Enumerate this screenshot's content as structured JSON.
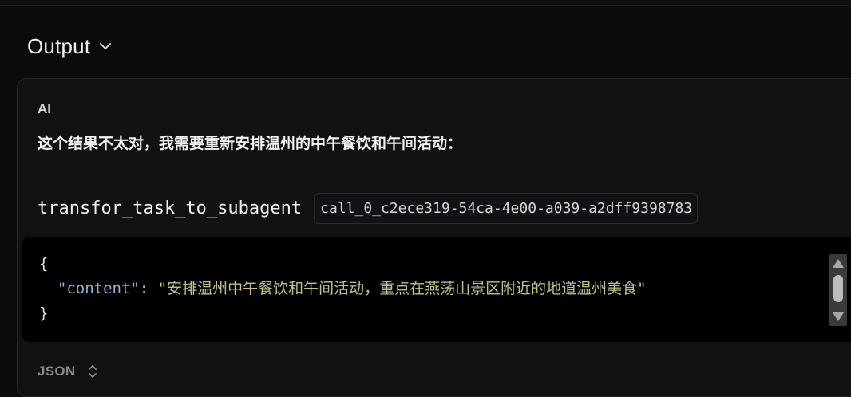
{
  "output": {
    "title": "Output"
  },
  "message": {
    "role_label": "AI",
    "text": "这个结果不太对，我需要重新安排温州的中午餐饮和午间活动："
  },
  "tool_call": {
    "name": "transfor_task_to_subagent",
    "call_id": "call_0_c2ece319-54ca-4e00-a039-a2dff9398783",
    "args": {
      "open_brace": "{",
      "key": "\"content\"",
      "colon": ": ",
      "value": "\"安排温州中午餐饮和午间活动，重点在燕荡山景区附近的地道温州美食\"",
      "close_brace": "}"
    }
  },
  "footer": {
    "format_label": "JSON"
  },
  "icons": {
    "output_toggle": "chevron-down-icon",
    "format_toggle": "chevron-up-down-icon",
    "scroll_up": "scroll-up-arrow-icon",
    "scroll_down": "scroll-down-arrow-icon"
  }
}
